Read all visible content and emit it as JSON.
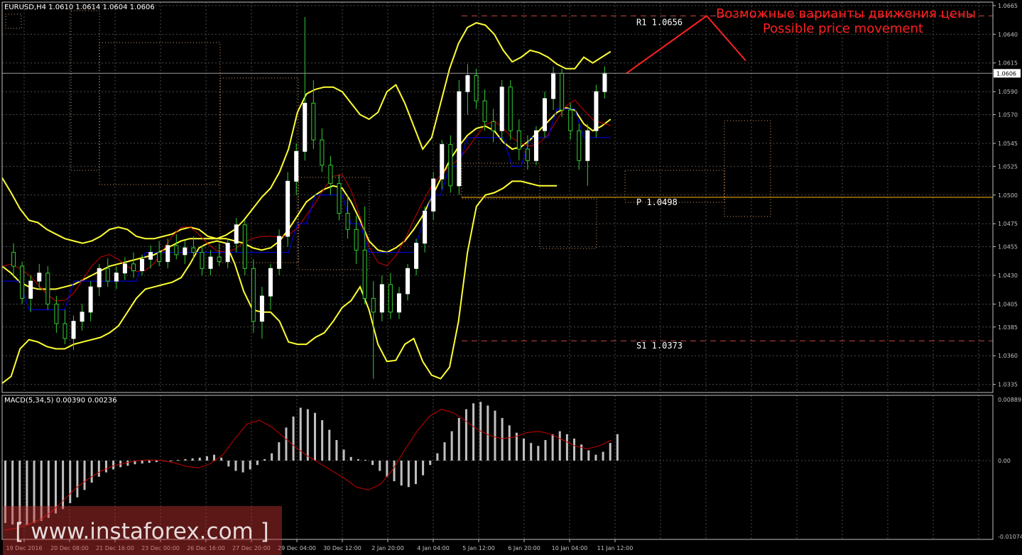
{
  "header": {
    "symbol_line": "EURUSD,H4  1.0610 1.0614 1.0604 1.0606",
    "macd_label": "MACD(5,34,5) 0.00390 0.00236"
  },
  "annotation": {
    "ru": "Возможные варианты движения цены",
    "en": "Possible price movement"
  },
  "watermark": {
    "text": "[ www.instaforex.com ]"
  },
  "colors": {
    "background": "#000000",
    "grid": "#4a4a4a",
    "axis": "#c0c0c0",
    "bull_candle": "#ffffff",
    "bear_candle": "#33cc33",
    "bollinger": "#ffff33",
    "tenkan": "#cc0000",
    "kijun": "#0000ff",
    "chikou": "#33cc33",
    "cloud": "#e8a66a",
    "levels": "#cc4444",
    "pivot": "#ffb300",
    "annotation": "#ff2020",
    "macd_hist": "#c0c0c0",
    "macd_signal": "#cc0000",
    "watermark": "#cc3333"
  },
  "chart_data": [
    {
      "type": "candlestick",
      "symbol": "EURUSD",
      "timeframe": "H4",
      "ohlc_last": {
        "open": 1.061,
        "high": 1.0614,
        "low": 1.0604,
        "close": 1.0606
      },
      "current_price": "1.0606",
      "ylim": [
        1.0328,
        1.0668
      ],
      "y_ticks": [
        "1.0665",
        "1.0640",
        "1.0615",
        "1.0590",
        "1.0570",
        "1.0545",
        "1.0525",
        "1.0500",
        "1.0475",
        "1.0455",
        "1.0430",
        "1.0405",
        "1.0385",
        "1.0360",
        "1.0335"
      ],
      "x_tick_labels": [
        "19 Dec 2016",
        "20 Dec 08:00",
        "21 Dec 16:00",
        "23 Dec 00:00",
        "26 Dec 16:00",
        "27 Dec 20:00",
        "29 Dec 04:00",
        "30 Dec 12:00",
        "2 Jan 20:00",
        "4 Jan 04:00",
        "5 Jan 12:00",
        "6 Jan 20:00",
        "10 Jan 04:00",
        "11 Jan 12:00"
      ],
      "levels": [
        {
          "name": "R1",
          "label": "R1  1.0656",
          "value": 1.0656
        },
        {
          "name": "P",
          "label": "P  1.0498",
          "value": 1.0498
        },
        {
          "name": "S1",
          "label": "S1  1.0373",
          "value": 1.0373
        }
      ],
      "forecast_path": [
        [
          0,
          1.0606
        ],
        [
          1,
          1.0656
        ],
        [
          2,
          1.0617
        ]
      ],
      "candles": [
        [
          1.045,
          1.0458,
          1.0428,
          1.0438
        ],
        [
          1.0438,
          1.0442,
          1.0405,
          1.041
        ],
        [
          1.041,
          1.043,
          1.0398,
          1.0425
        ],
        [
          1.0425,
          1.044,
          1.0418,
          1.0432
        ],
        [
          1.0432,
          1.0438,
          1.04,
          1.0405
        ],
        [
          1.0405,
          1.0412,
          1.038,
          1.0388
        ],
        [
          1.0388,
          1.04,
          1.037,
          1.0375
        ],
        [
          1.0375,
          1.0395,
          1.0365,
          1.039
        ],
        [
          1.039,
          1.0405,
          1.0382,
          1.0398
        ],
        [
          1.0398,
          1.0425,
          1.039,
          1.042
        ],
        [
          1.042,
          1.044,
          1.0412,
          1.0436
        ],
        [
          1.0436,
          1.0445,
          1.042,
          1.0425
        ],
        [
          1.0425,
          1.0438,
          1.0418,
          1.0432
        ],
        [
          1.0432,
          1.0446,
          1.0426,
          1.044
        ],
        [
          1.044,
          1.045,
          1.0428,
          1.0434
        ],
        [
          1.0434,
          1.0448,
          1.043,
          1.0444
        ],
        [
          1.0444,
          1.0456,
          1.0436,
          1.045
        ],
        [
          1.045,
          1.046,
          1.0438,
          1.0442
        ],
        [
          1.0442,
          1.0462,
          1.0436,
          1.0456
        ],
        [
          1.0456,
          1.0466,
          1.0444,
          1.0448
        ],
        [
          1.0448,
          1.046,
          1.044,
          1.0454
        ],
        [
          1.0454,
          1.0464,
          1.0444,
          1.045
        ],
        [
          1.045,
          1.0456,
          1.043,
          1.0436
        ],
        [
          1.0436,
          1.0452,
          1.043,
          1.0446
        ],
        [
          1.0446,
          1.0458,
          1.0438,
          1.0442
        ],
        [
          1.0442,
          1.0462,
          1.0436,
          1.0458
        ],
        [
          1.0458,
          1.048,
          1.045,
          1.0474
        ],
        [
          1.0474,
          1.0478,
          1.043,
          1.0436
        ],
        [
          1.0436,
          1.0444,
          1.038,
          1.039
        ],
        [
          1.039,
          1.042,
          1.0375,
          1.0412
        ],
        [
          1.0412,
          1.044,
          1.04,
          1.0436
        ],
        [
          1.0436,
          1.047,
          1.043,
          1.0464
        ],
        [
          1.0464,
          1.052,
          1.0455,
          1.0512
        ],
        [
          1.0512,
          1.0545,
          1.05,
          1.0538
        ],
        [
          1.0538,
          1.0655,
          1.053,
          1.058
        ],
        [
          1.058,
          1.06,
          1.054,
          1.0548
        ],
        [
          1.0548,
          1.0558,
          1.052,
          1.0526
        ],
        [
          1.0526,
          1.0534,
          1.05,
          1.051
        ],
        [
          1.051,
          1.0518,
          1.0478,
          1.0484
        ],
        [
          1.0484,
          1.05,
          1.0462,
          1.047
        ],
        [
          1.047,
          1.0482,
          1.044,
          1.0452
        ],
        [
          1.0452,
          1.049,
          1.0405,
          1.041
        ],
        [
          1.041,
          1.0425,
          1.034,
          1.0398
        ],
        [
          1.0398,
          1.043,
          1.039,
          1.0422
        ],
        [
          1.0422,
          1.0432,
          1.0392,
          1.0398
        ],
        [
          1.0398,
          1.042,
          1.0392,
          1.0414
        ],
        [
          1.0414,
          1.044,
          1.0408,
          1.0436
        ],
        [
          1.0436,
          1.0462,
          1.043,
          1.0458
        ],
        [
          1.0458,
          1.049,
          1.045,
          1.0486
        ],
        [
          1.0486,
          1.052,
          1.0478,
          1.0514
        ],
        [
          1.0514,
          1.0548,
          1.0505,
          1.0544
        ],
        [
          1.0544,
          1.0552,
          1.0502,
          1.0508
        ],
        [
          1.0508,
          1.06,
          1.05,
          1.059
        ],
        [
          1.059,
          1.0614,
          1.057,
          1.0604
        ],
        [
          1.0604,
          1.061,
          1.0575,
          1.0582
        ],
        [
          1.0582,
          1.0592,
          1.0556,
          1.0564
        ],
        [
          1.0564,
          1.0575,
          1.0546,
          1.0556
        ],
        [
          1.0556,
          1.06,
          1.0548,
          1.0594
        ],
        [
          1.0594,
          1.06,
          1.0548,
          1.0556
        ],
        [
          1.0556,
          1.0566,
          1.053,
          1.054
        ],
        [
          1.054,
          1.0552,
          1.0522,
          1.053
        ],
        [
          1.053,
          1.056,
          1.0526,
          1.0556
        ],
        [
          1.0556,
          1.059,
          1.055,
          1.0584
        ],
        [
          1.0584,
          1.0612,
          1.0574,
          1.0606
        ],
        [
          1.0606,
          1.061,
          1.0568,
          1.0574
        ],
        [
          1.0574,
          1.058,
          1.0548,
          1.0556
        ],
        [
          1.0556,
          1.0562,
          1.0522,
          1.053
        ],
        [
          1.053,
          1.0562,
          1.0508,
          1.0556
        ],
        [
          1.0556,
          1.0596,
          1.055,
          1.059
        ],
        [
          1.059,
          1.0612,
          1.0584,
          1.0606
        ]
      ],
      "bollinger_upper": [
        1.0515,
        1.0502,
        1.0488,
        1.0478,
        1.0476,
        1.047,
        1.0466,
        1.0462,
        1.046,
        1.0458,
        1.046,
        1.0464,
        1.047,
        1.0472,
        1.047,
        1.0464,
        1.0462,
        1.0462,
        1.0464,
        1.0466,
        1.047,
        1.0472,
        1.047,
        1.0464,
        1.0462,
        1.0465,
        1.047,
        1.0478,
        1.0488,
        1.0498,
        1.0506,
        1.052,
        1.054,
        1.0572,
        1.0588,
        1.0592,
        1.0594,
        1.0594,
        1.059,
        1.058,
        1.057,
        1.0566,
        1.0572,
        1.059,
        1.0596,
        1.058,
        1.056,
        1.054,
        1.055,
        1.058,
        1.061,
        1.0632,
        1.0646,
        1.065,
        1.0648,
        1.064,
        1.0626,
        1.0616,
        1.062,
        1.0626,
        1.0624,
        1.062,
        1.0614,
        1.061,
        1.061,
        1.062,
        1.0615,
        1.062,
        1.0625
      ],
      "bollinger_middle": [
        1.0438,
        1.0432,
        1.0424,
        1.042,
        1.0418,
        1.0418,
        1.0418,
        1.042,
        1.0422,
        1.0426,
        1.043,
        1.0434,
        1.0438,
        1.044,
        1.0442,
        1.0444,
        1.0446,
        1.0448,
        1.0452,
        1.0456,
        1.046,
        1.0462,
        1.0462,
        1.0462,
        1.0462,
        1.0462,
        1.046,
        1.0458,
        1.0454,
        1.0452,
        1.0454,
        1.046,
        1.047,
        1.0482,
        1.0494,
        1.05,
        1.0505,
        1.0508,
        1.0506,
        1.0494,
        1.0478,
        1.046,
        1.0452,
        1.045,
        1.0454,
        1.046,
        1.047,
        1.0482,
        1.0498,
        1.0514,
        1.053,
        1.0542,
        1.0552,
        1.0558,
        1.056,
        1.0556,
        1.0546,
        1.054,
        1.0542,
        1.0548,
        1.0556,
        1.0564,
        1.0572,
        1.0576,
        1.0574,
        1.0562,
        1.0556,
        1.056,
        1.0566
      ],
      "bollinger_lower": [
        1.0336,
        1.0342,
        1.0366,
        1.0374,
        1.0372,
        1.0368,
        1.0366,
        1.0366,
        1.037,
        1.0372,
        1.0374,
        1.0376,
        1.038,
        1.0386,
        1.0398,
        1.041,
        1.0418,
        1.042,
        1.0422,
        1.0424,
        1.0428,
        1.044,
        1.0454,
        1.0458,
        1.046,
        1.0458,
        1.044,
        1.0416,
        1.04,
        1.0398,
        1.0398,
        1.039,
        1.0372,
        1.037,
        1.037,
        1.0376,
        1.038,
        1.039,
        1.0402,
        1.0408,
        1.042,
        1.04,
        1.037,
        1.0355,
        1.0356,
        1.037,
        1.0375,
        1.0355,
        1.0343,
        1.034,
        1.035,
        1.039,
        1.045,
        1.049,
        1.05,
        1.0502,
        1.0506,
        1.0512,
        1.0512,
        1.051,
        1.0508,
        1.0508,
        1.0508
      ],
      "macd": {
        "label": "MACD(5,34,5) 0.00390 0.00236",
        "ylim": [
          -0.01074,
          0.00889
        ],
        "y_ticks": [
          "0.00889",
          "0.00",
          "-0.01074"
        ],
        "histogram": [
          -0.0085,
          -0.0087,
          -0.0088,
          -0.0088,
          -0.0085,
          -0.0082,
          -0.0078,
          -0.0072,
          -0.0066,
          -0.0058,
          -0.005,
          -0.004,
          -0.003,
          -0.0022,
          -0.0016,
          -0.0012,
          -0.0009,
          -0.0007,
          -0.0005,
          -0.0004,
          -0.0003,
          -0.0002,
          -0.0001,
          0.0,
          0.0001,
          0.0002,
          0.0003,
          0.0004,
          0.0006,
          0.0008,
          0.0004,
          -0.0008,
          -0.0014,
          -0.0016,
          -0.0012,
          -0.0006,
          0.0002,
          0.001,
          0.0025,
          0.0045,
          0.006,
          0.0072,
          0.007,
          0.0065,
          0.0055,
          0.0042,
          0.0028,
          0.0015,
          0.0005,
          0.0002,
          0.0001,
          -0.0006,
          -0.0014,
          -0.0022,
          -0.0028,
          -0.0034,
          -0.0036,
          -0.0032,
          -0.002,
          -0.0006,
          0.001,
          0.0025,
          0.004,
          0.0058,
          0.007,
          0.0078,
          0.008,
          0.0075,
          0.0068,
          0.0058,
          0.0048,
          0.0038,
          0.003,
          0.0024,
          0.002,
          0.0028,
          0.0036,
          0.004,
          0.0036,
          0.003,
          0.0022,
          0.0014,
          0.0008,
          0.0012,
          0.0024,
          0.0036
        ],
        "signal": [
          -0.0095,
          -0.0092,
          -0.0087,
          -0.008,
          -0.0068,
          -0.0052,
          -0.0036,
          -0.0024,
          -0.0014,
          -0.0007,
          -0.0003,
          0.0,
          0.0001,
          0.0,
          -0.0003,
          -0.0008,
          -0.001,
          -0.0004,
          0.0008,
          0.003,
          0.005,
          0.0055,
          0.0046,
          0.0032,
          0.0018,
          0.0006,
          -0.0004,
          -0.0014,
          -0.0024,
          -0.0036,
          -0.004,
          -0.0032,
          -0.0012,
          0.0015,
          0.004,
          0.006,
          0.007,
          0.0065,
          0.0054,
          0.0042,
          0.0034,
          0.003,
          0.0032,
          0.0038,
          0.004,
          0.0036,
          0.0028,
          0.002,
          0.0016,
          0.002,
          0.0028
        ]
      }
    }
  ]
}
